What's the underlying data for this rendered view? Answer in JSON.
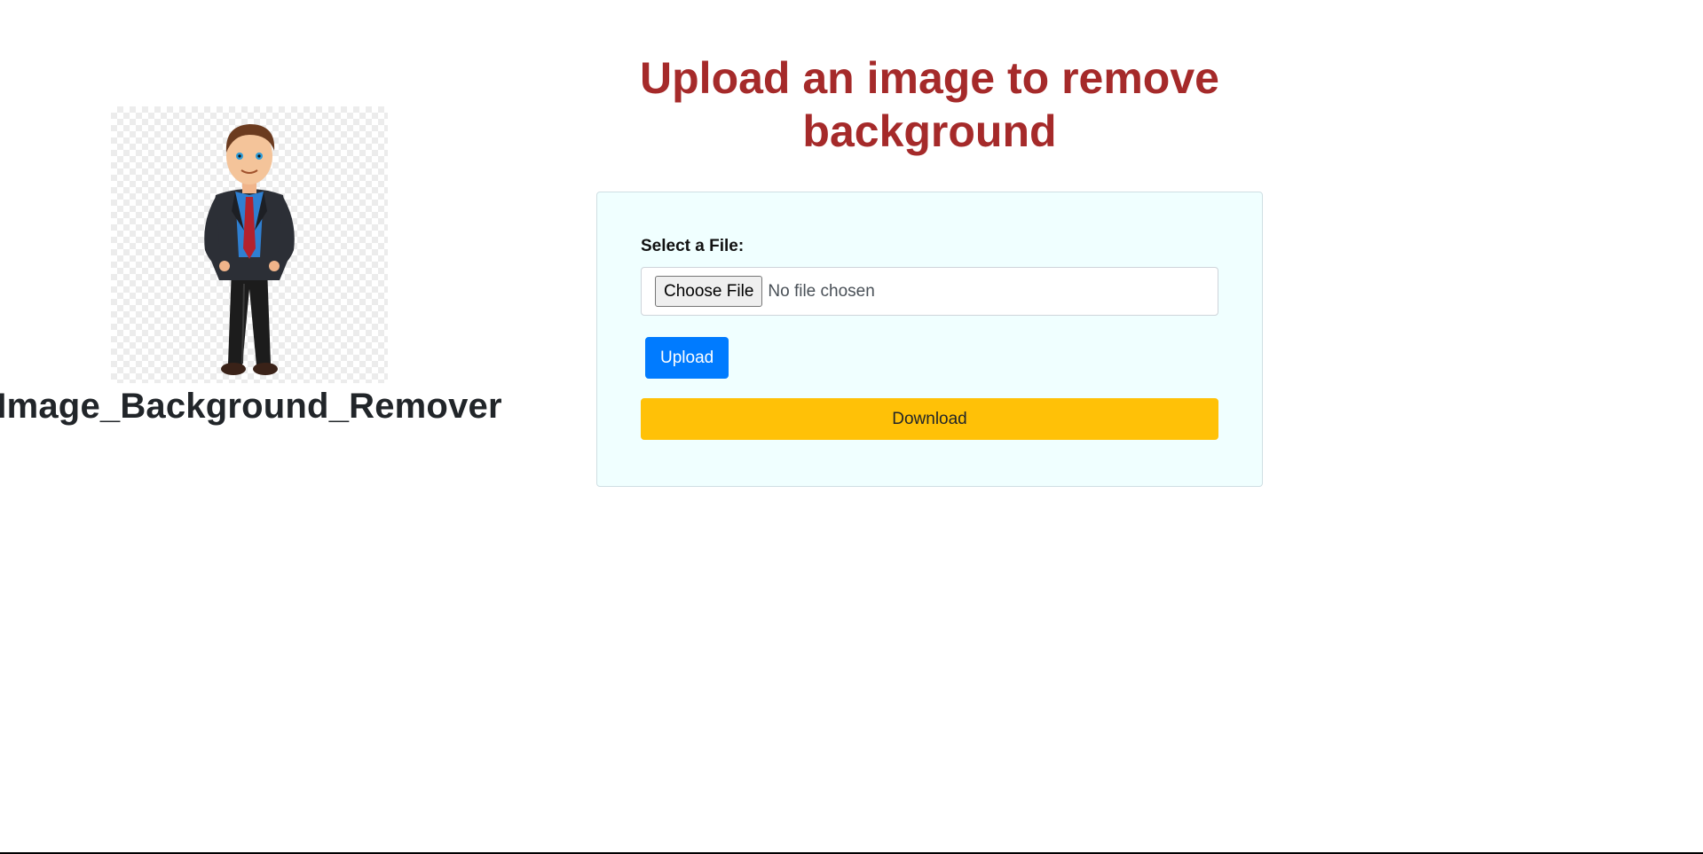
{
  "brand": {
    "logo_icon": "businessman-cartoon-icon",
    "title": "Image_Background_Remover"
  },
  "main": {
    "heading": "Upload an image to remove background",
    "form": {
      "file_label": "Select a File:",
      "choose_file_label": "Choose File",
      "file_status": "No file chosen",
      "upload_label": "Upload",
      "download_label": "Download"
    }
  },
  "colors": {
    "heading": "#a52a2a",
    "card_background": "#f0ffff",
    "upload_button": "#007bff",
    "download_button": "#ffc107"
  }
}
